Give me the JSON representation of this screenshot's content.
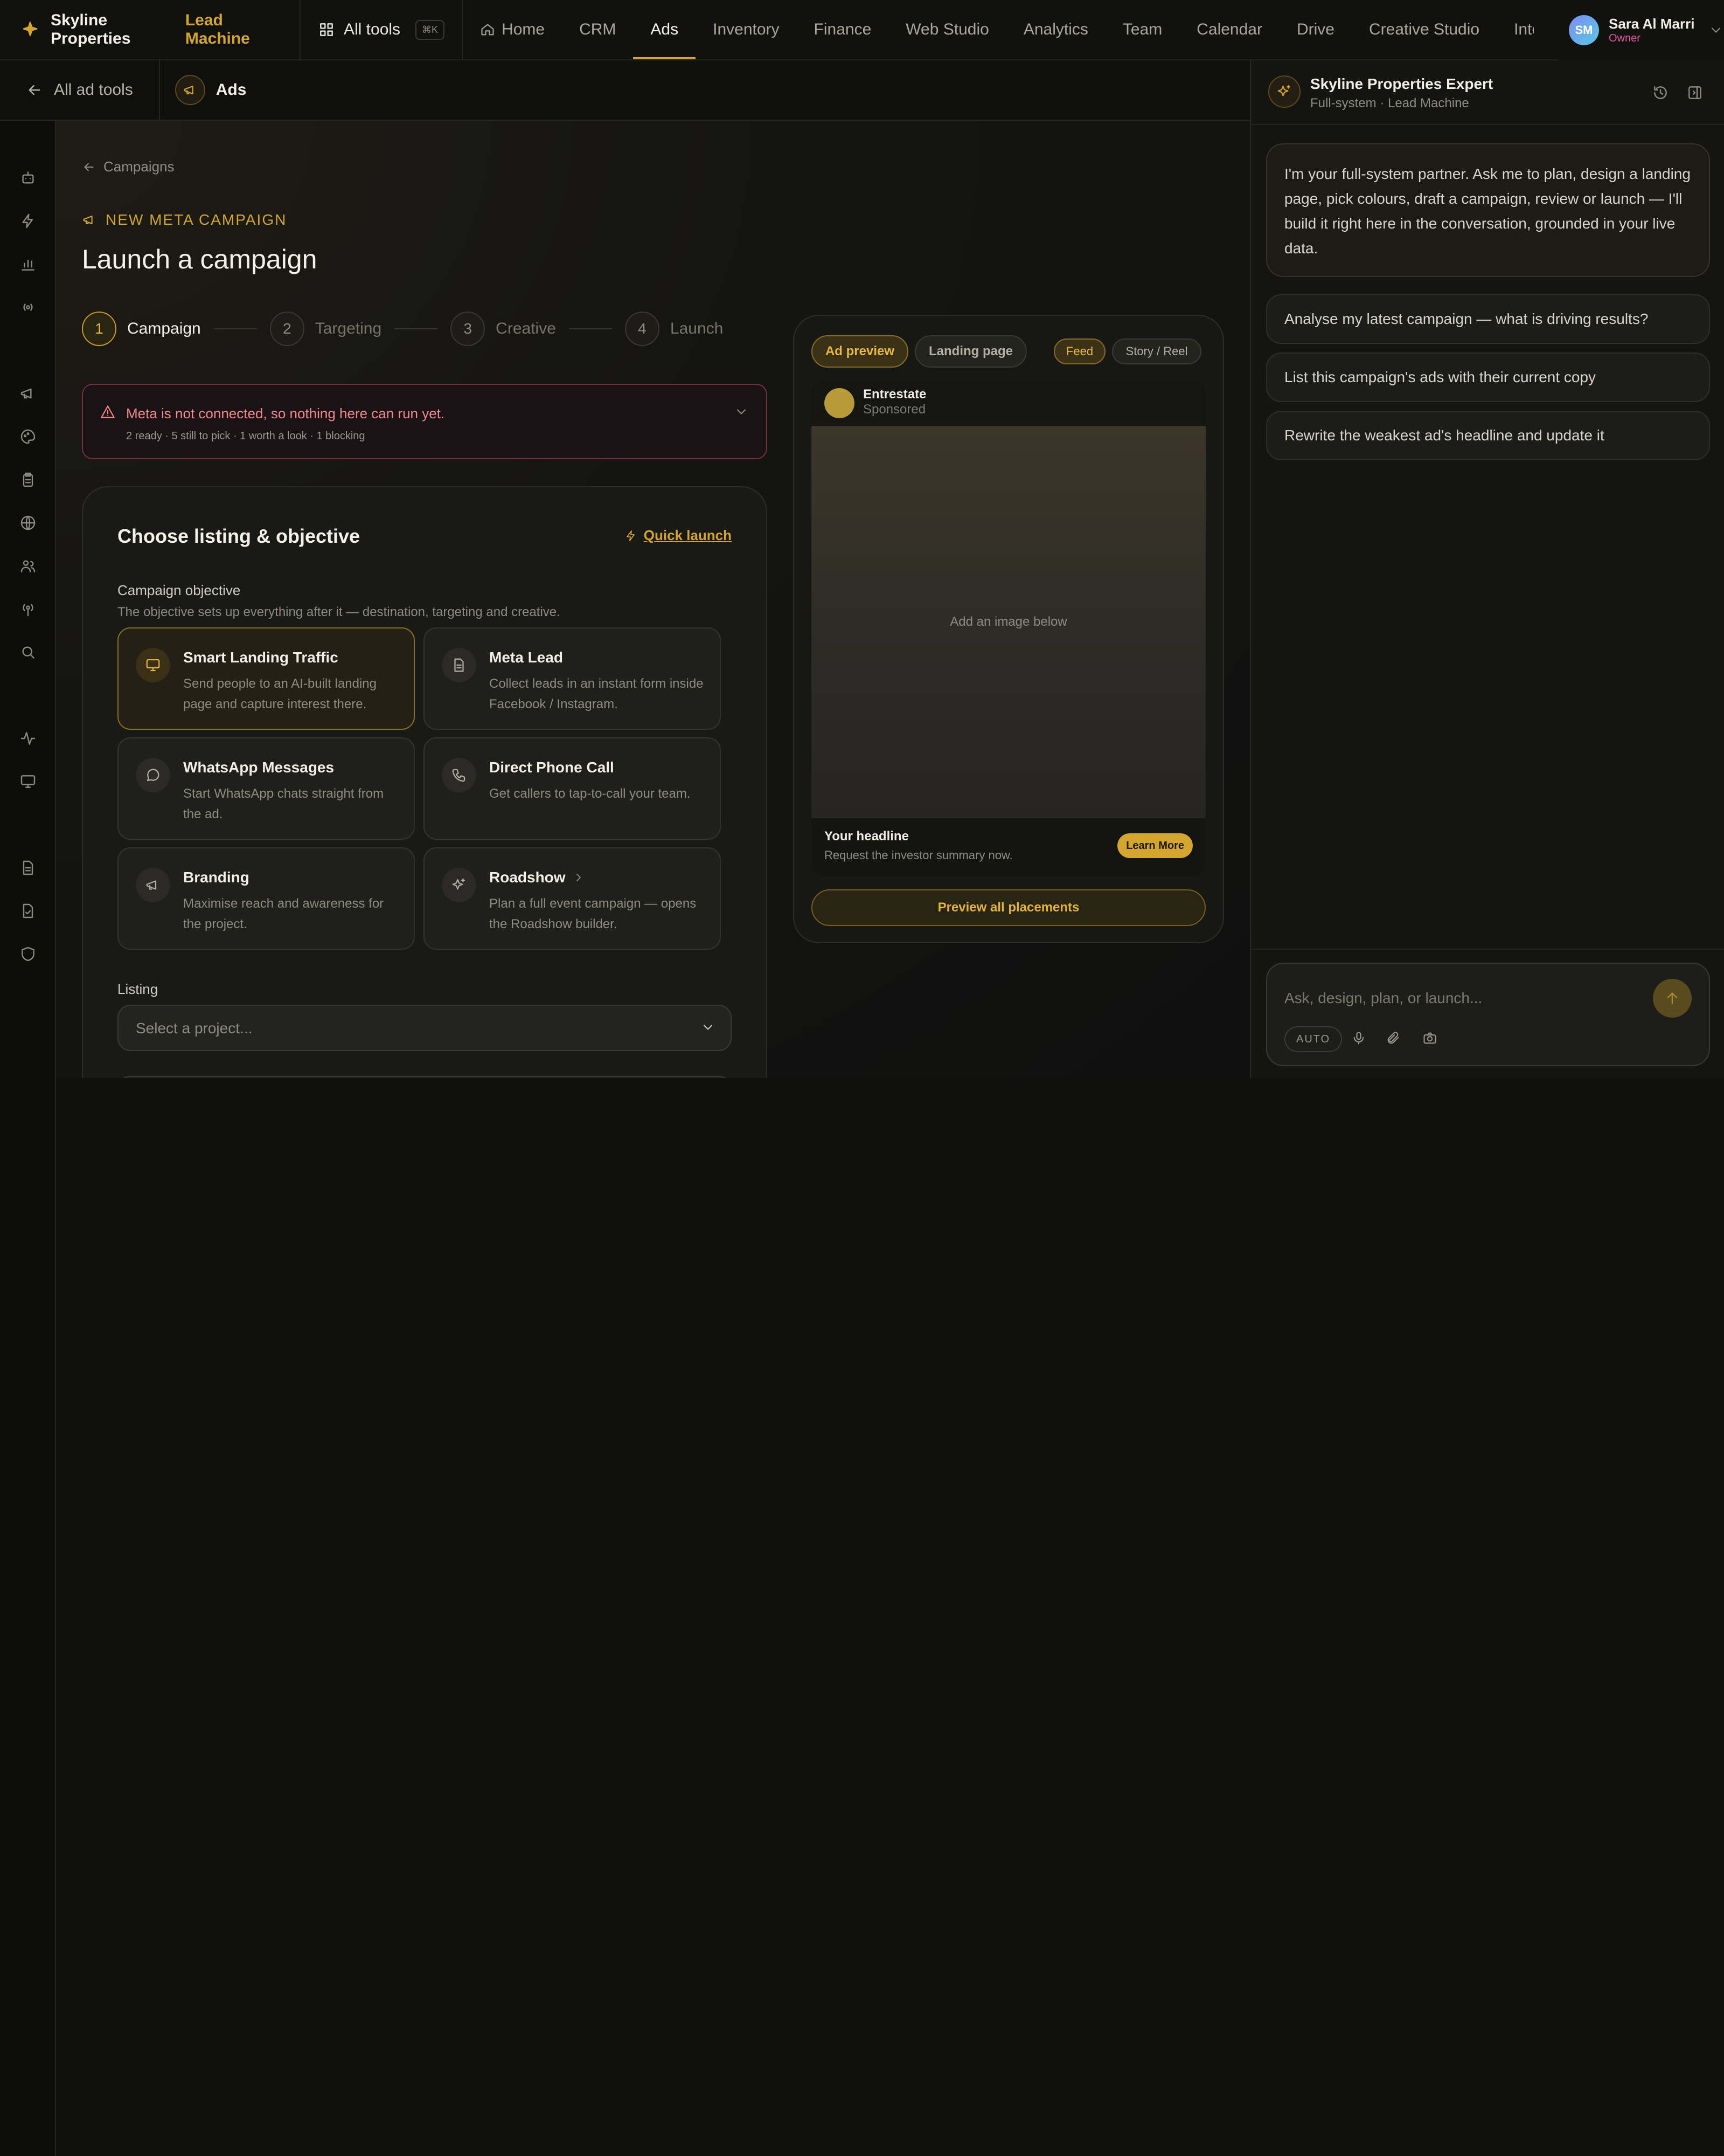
{
  "nav": {
    "brand": "Skyline Properties",
    "brand_accent": "Lead Machine",
    "all_tools": "All tools",
    "shortcut": "⌘K",
    "links": [
      "Home",
      "CRM",
      "Ads",
      "Inventory",
      "Finance",
      "Web Studio",
      "Analytics",
      "Team",
      "Calendar",
      "Drive",
      "Creative Studio",
      "Integ"
    ],
    "active": "Ads",
    "user": {
      "initials": "SM",
      "name": "Sara Al Marri",
      "role": "Owner"
    }
  },
  "subheader": {
    "back": "All ad tools",
    "section": "Ads"
  },
  "rail_icons": [
    "bot-icon",
    "bolt-icon",
    "bar-chart-icon",
    "broadcast-icon",
    "megaphone-icon",
    "palette-icon",
    "clipboard-icon",
    "globe-icon",
    "users-icon",
    "antenna-icon",
    "search-icon",
    "activity-icon",
    "monitor-icon",
    "file-icon",
    "file-check-icon",
    "shield-icon"
  ],
  "page": {
    "breadcrumb": "Campaigns",
    "eyebrow": "NEW META CAMPAIGN",
    "title": "Launch a campaign",
    "steps": [
      {
        "num": "1",
        "label": "Campaign"
      },
      {
        "num": "2",
        "label": "Targeting"
      },
      {
        "num": "3",
        "label": "Creative"
      },
      {
        "num": "4",
        "label": "Launch"
      }
    ],
    "active_step": 1,
    "warning": {
      "title": "Meta is not connected, so nothing here can run yet.",
      "summary": "2 ready · 5 still to pick · 1 worth a look · 1 blocking"
    },
    "card": {
      "title": "Choose listing & objective",
      "quick_launch": "Quick launch",
      "objective_label": "Campaign objective",
      "objective_help": "The objective sets up everything after it — destination, targeting and creative.",
      "options": [
        {
          "title": "Smart Landing Traffic",
          "desc": "Send people to an AI-built landing page and capture interest there.",
          "icon": "monitor-icon",
          "selected": true
        },
        {
          "title": "Meta Lead",
          "desc": "Collect leads in an instant form inside Facebook / Instagram.",
          "icon": "file-icon"
        },
        {
          "title": "WhatsApp Messages",
          "desc": "Start WhatsApp chats straight from the ad.",
          "icon": "chat-icon"
        },
        {
          "title": "Direct Phone Call",
          "desc": "Get callers to tap-to-call your team.",
          "icon": "phone-icon"
        },
        {
          "title": "Branding",
          "desc": "Maximise reach and awareness for the project.",
          "icon": "megaphone-icon"
        },
        {
          "title": "Roadshow",
          "desc": "Plan a full event campaign — opens the Roadshow builder.",
          "icon": "sparkle-icon"
        }
      ],
      "listing_label": "Listing",
      "listing_placeholder": "Select a project..."
    }
  },
  "preview": {
    "tabs": [
      "Ad preview",
      "Landing page"
    ],
    "placements": [
      "Feed",
      "Story / Reel"
    ],
    "page_name": "Entrestate",
    "sponsored": "Sponsored",
    "image_placeholder": "Add an image below",
    "headline": "Your headline",
    "subline": "Request the investor summary now.",
    "cta": "Learn More",
    "preview_all": "Preview all placements"
  },
  "assistant": {
    "title": "Skyline Properties Expert",
    "subtitle": "Full-system · Lead Machine",
    "intro": "I'm your full-system partner. Ask me to plan, design a landing page, pick colours, draft a campaign, review or launch — I'll build it right here in the conversation, grounded in your live data.",
    "suggestions": [
      "Analyse my latest campaign — what is driving results?",
      "List this campaign's ads with their current copy",
      "Rewrite the weakest ad's headline and update it"
    ],
    "input_placeholder": "Ask, design, plan, or launch...",
    "mode": "AUTO"
  },
  "colors": {
    "accent": "#d4a52f",
    "danger": "#f08a8e",
    "bg": "#0f0f0e"
  }
}
